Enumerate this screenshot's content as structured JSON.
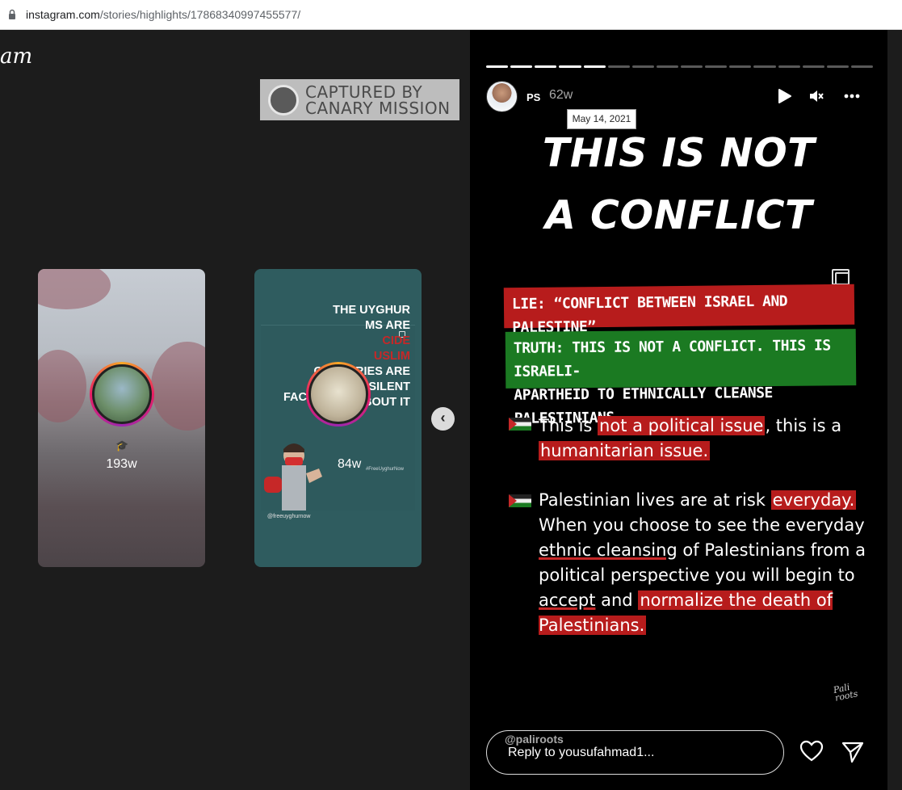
{
  "browser": {
    "url_domain": "instagram.com",
    "url_path": "/stories/highlights/17868340997455577/"
  },
  "logo_fragment": "am",
  "watermark": {
    "line1": "CAPTURED BY",
    "line2": "CANARY MISSION"
  },
  "highlights": [
    {
      "age": "193w",
      "icon": "graduation-cap-icon"
    },
    {
      "age": "84w",
      "lines": [
        "THE UYGHUR",
        "MS ARE",
        "CIDE",
        "USLIM",
        "COUNTRIES ARE",
        "STAYING SILENT",
        "ABOUT IT"
      ],
      "fac_text": "FAC",
      "hashtag": "#FreeUyghurNow",
      "handle": "@freeuyghurnow"
    }
  ],
  "story": {
    "progress": {
      "total_segments": 16,
      "completed_segments": 5
    },
    "username": "PS",
    "age": "62w",
    "date_tooltip": "May 14, 2021",
    "headline_line1": "THIS IS NOT",
    "headline_line2": "A CONFLICT",
    "lie_banner": "LIE: “CONFLICT BETWEEN ISRAEL AND PALESTINE”",
    "truth_banner_line1": "TRUTH: THIS IS NOT A CONFLICT. THIS IS ISRAELI-",
    "truth_banner_line2": "APARTHEID TO ETHNICALLY CLEANSE PALESTINIANS.",
    "point1": {
      "a": "This is ",
      "b": "not a political issue",
      "c": ", this is a ",
      "d": "humanitarian issue."
    },
    "point2": {
      "a": "Palestinian lives are at risk ",
      "b": "everyday.",
      "c": " When you choose to see the everyday ",
      "d": "ethnic cleansing",
      "e": " of Palestinians from a political perspective you will begin to ",
      "f": "accept",
      "g": " and ",
      "h": "normalize the death of Palestinians."
    },
    "signature": "Pali roots",
    "reply_tag": "@paliroots",
    "reply_placeholder": "Reply to yousufahmad1...",
    "colors": {
      "red": "#b71c1c",
      "green": "#1b7a22"
    }
  }
}
